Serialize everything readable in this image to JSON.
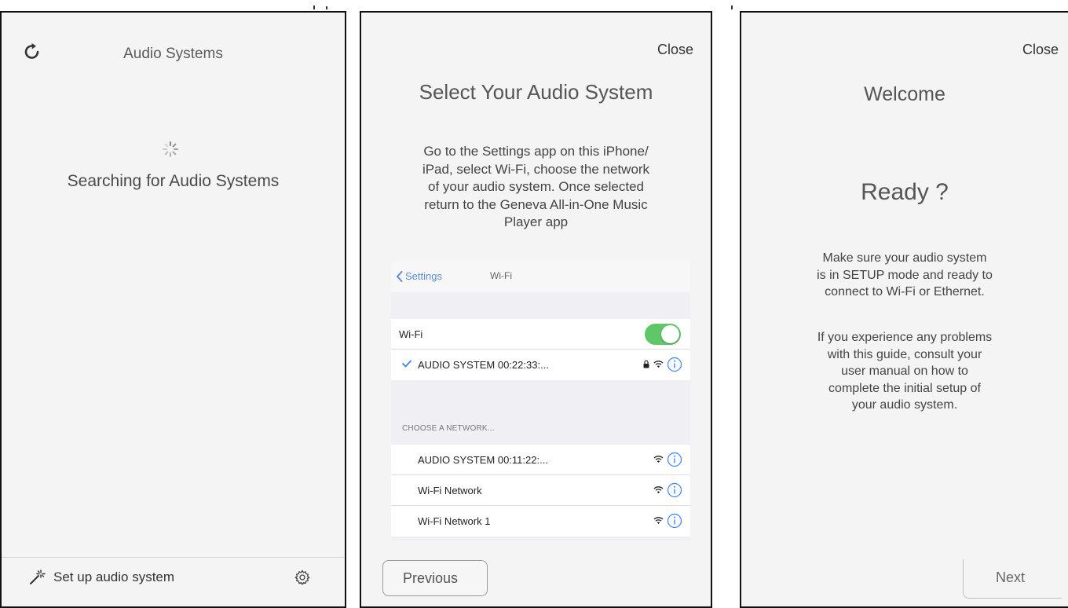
{
  "panel1": {
    "title": "Audio Systems",
    "status": "Searching for Audio Systems",
    "setup_label": "Set up audio system",
    "icons": {
      "refresh": "refresh-icon",
      "spinner": "spinner-icon",
      "setup": "magic-wand-icon",
      "settings": "gear-icon"
    }
  },
  "panel2": {
    "close_label": "Close",
    "title": "Select Your Audio System",
    "instruction_lines": [
      "Go to the Settings app on this iPhone/",
      "iPad, select Wi-Fi, choose the network",
      "of your audio system. Once selected",
      "return to the Geneva All-in-One Music",
      "Player app"
    ],
    "wifi_screenshot": {
      "back_label": "Settings",
      "nav_title": "Wi-Fi",
      "wifi_row_label": "Wi-Fi",
      "wifi_enabled": true,
      "connected_network": "AUDIO SYSTEM 00:22:33:...",
      "section_header": "CHOOSE A NETWORK...",
      "networks": [
        {
          "name": "AUDIO SYSTEM 00:11:22:..."
        },
        {
          "name": "Wi-Fi Network"
        },
        {
          "name": "Wi-Fi Network 1"
        }
      ]
    },
    "previous_label": "Previous"
  },
  "panel3": {
    "close_label": "Close",
    "title": "Welcome",
    "heading": "Ready ?",
    "paragraph1_lines": [
      "Make sure your audio system",
      "is in SETUP mode and ready to",
      "connect to Wi-Fi or Ethernet."
    ],
    "paragraph2_lines": [
      "If you experience any problems",
      "with this guide, consult your",
      "user manual on how to",
      "complete the initial setup of",
      "your audio system."
    ],
    "next_label": "Next"
  },
  "colors": {
    "panel_background": "#f4f4f4",
    "panel_border": "#111111",
    "toggle_on": "#5fc768",
    "ios_link_blue": "#5b8ddb",
    "info_blue": "#3b82f6"
  }
}
